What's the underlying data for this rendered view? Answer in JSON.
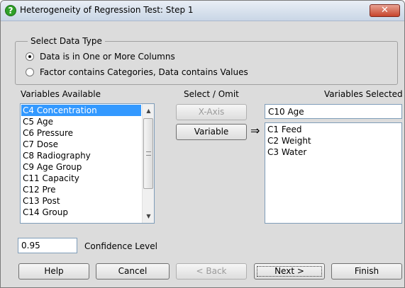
{
  "window": {
    "title": "Heterogeneity of Regression Test: Step 1",
    "close_label": "✕"
  },
  "data_type": {
    "legend": "Select Data Type",
    "options": [
      {
        "label": "Data is in One or More Columns",
        "selected": true
      },
      {
        "label": "Factor contains Categories, Data contains Values",
        "selected": false
      }
    ]
  },
  "variables_available": {
    "label": "Variables Available",
    "items": [
      "C4 Concentration",
      "C5 Age",
      "C6 Pressure",
      "C7 Dose",
      "C8 Radiography",
      "C9 Age Group",
      "C11 Capacity",
      "C12 Pre",
      "C13 Post",
      "C14 Group"
    ],
    "selected_index": 0
  },
  "select_omit": {
    "label": "Select / Omit",
    "xaxis_button": "X-Axis",
    "variable_button": "Variable",
    "arrow": "⇒"
  },
  "variables_selected": {
    "label": "Variables Selected",
    "xaxis_value": "C10 Age",
    "items": [
      "C1 Feed",
      "C2 Weight",
      "C3 Water"
    ]
  },
  "confidence": {
    "value": "0.95",
    "label": "Confidence Level"
  },
  "buttons": {
    "help": "Help",
    "cancel": "Cancel",
    "back": "< Back",
    "next": "Next >",
    "finish": "Finish"
  }
}
